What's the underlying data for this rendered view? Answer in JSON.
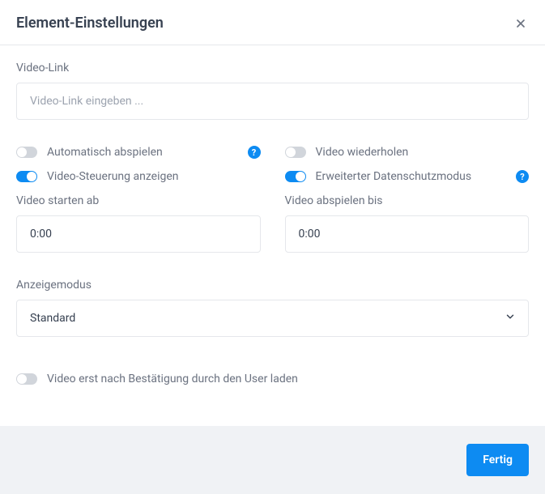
{
  "header": {
    "title": "Element-Einstellungen"
  },
  "videoLink": {
    "label": "Video-Link",
    "placeholder": "Video-Link eingeben ...",
    "value": ""
  },
  "toggles": {
    "autoplay": {
      "label": "Automatisch abspielen",
      "on": false
    },
    "loop": {
      "label": "Video wiederholen",
      "on": false
    },
    "controls": {
      "label": "Video-Steuerung anzeigen",
      "on": true
    },
    "privacy": {
      "label": "Erweiterter Datenschutzmodus",
      "on": true
    },
    "confirmLoad": {
      "label": "Video erst nach Bestätigung durch den User laden",
      "on": false
    }
  },
  "startAt": {
    "label": "Video starten ab",
    "value": "0:00"
  },
  "playUntil": {
    "label": "Video abspielen bis",
    "value": "0:00"
  },
  "displayMode": {
    "label": "Anzeigemodus",
    "selected": "Standard"
  },
  "footer": {
    "doneLabel": "Fertig"
  }
}
